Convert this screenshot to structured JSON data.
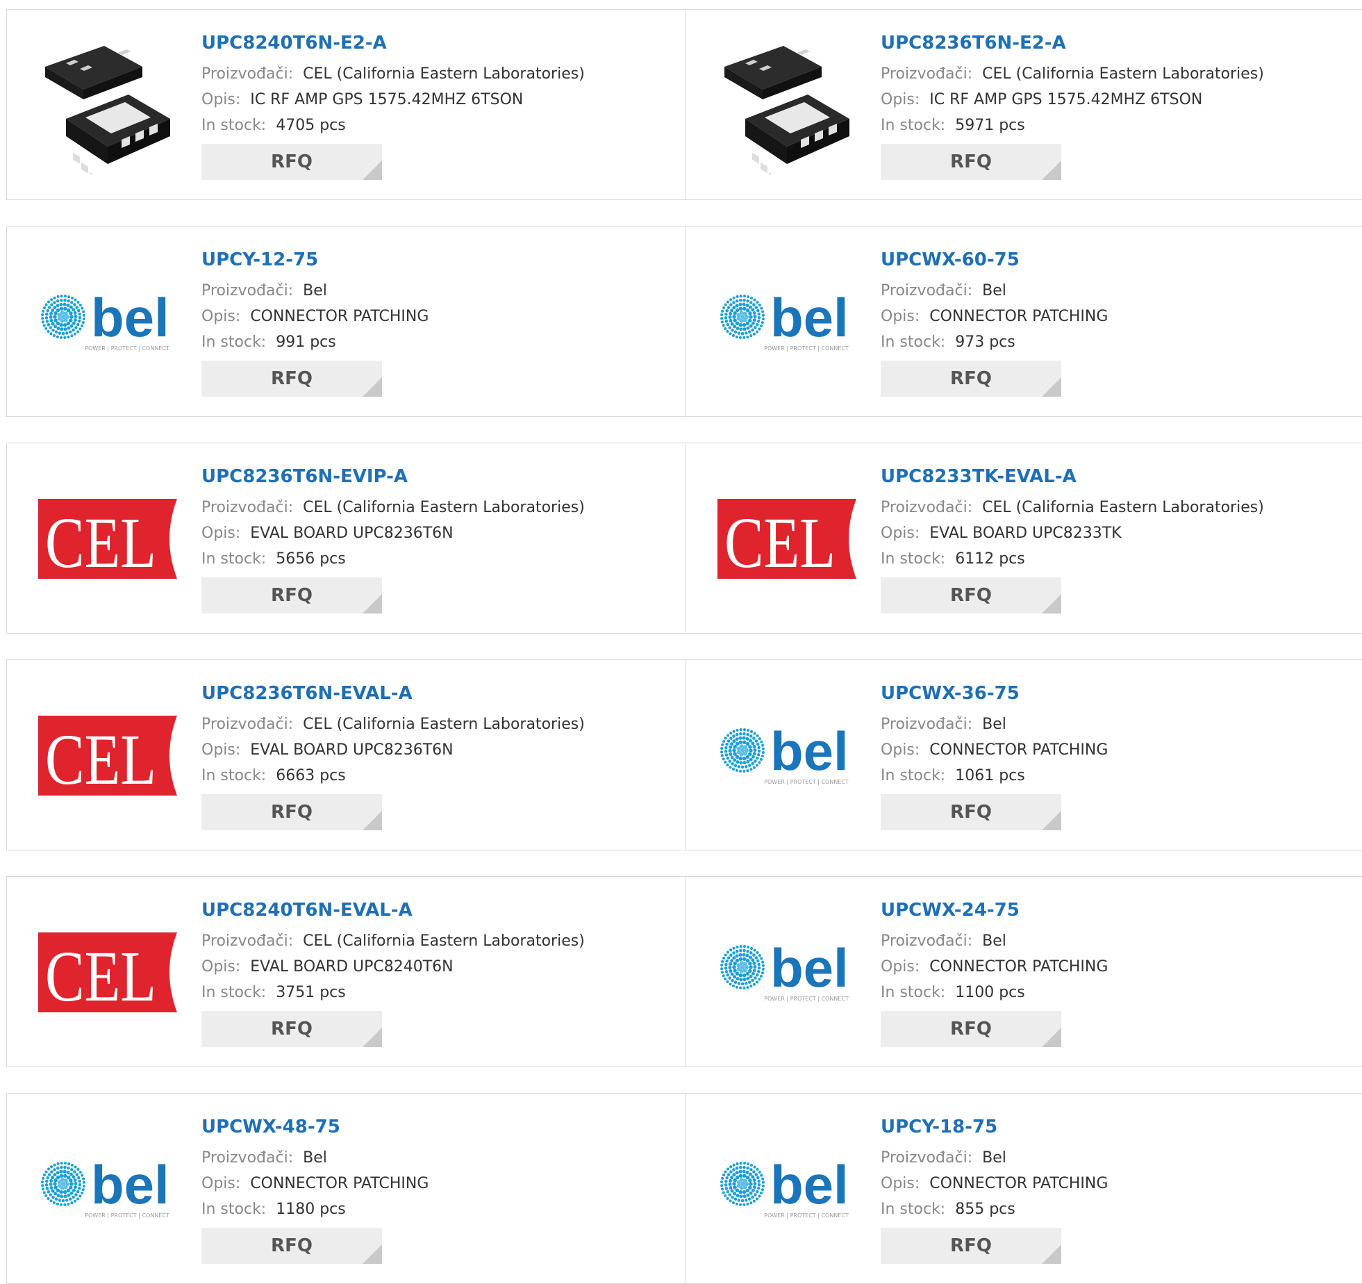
{
  "labels": {
    "manufacturer": "Proizvođači:",
    "description": "Opis:",
    "stock": "In stock:"
  },
  "colors": {
    "link": "#1f6fb5",
    "cel_red": "#e0242d",
    "bel_blue": "#1aa0d8",
    "bel_dark": "#1a75ba",
    "button_bg": "#ededed"
  },
  "products": [
    {
      "name": "UPC8240T6N-E2-A",
      "manufacturer": "CEL (California Eastern Laboratories)",
      "description": "IC RF AMP GPS 1575.42MHZ 6TSON",
      "stock": "4705 pcs",
      "image": "chip-package",
      "button": "RFQ"
    },
    {
      "name": "UPC8236T6N-E2-A",
      "manufacturer": "CEL (California Eastern Laboratories)",
      "description": "IC RF AMP GPS 1575.42MHZ 6TSON",
      "stock": "5971 pcs",
      "image": "chip-package",
      "button": "RFQ"
    },
    {
      "name": "UPCY-12-75",
      "manufacturer": "Bel",
      "description": "CONNECTOR PATCHING",
      "stock": "991 pcs",
      "image": "bel-logo",
      "button": "RFQ"
    },
    {
      "name": "UPCWX-60-75",
      "manufacturer": "Bel",
      "description": "CONNECTOR PATCHING",
      "stock": "973 pcs",
      "image": "bel-logo",
      "button": "RFQ"
    },
    {
      "name": "UPC8236T6N-EVIP-A",
      "manufacturer": "CEL (California Eastern Laboratories)",
      "description": "EVAL BOARD UPC8236T6N",
      "stock": "5656 pcs",
      "image": "cel-logo",
      "button": "RFQ"
    },
    {
      "name": "UPC8233TK-EVAL-A",
      "manufacturer": "CEL (California Eastern Laboratories)",
      "description": "EVAL BOARD UPC8233TK",
      "stock": "6112 pcs",
      "image": "cel-logo",
      "button": "RFQ"
    },
    {
      "name": "UPC8236T6N-EVAL-A",
      "manufacturer": "CEL (California Eastern Laboratories)",
      "description": "EVAL BOARD UPC8236T6N",
      "stock": "6663 pcs",
      "image": "cel-logo",
      "button": "RFQ"
    },
    {
      "name": "UPCWX-36-75",
      "manufacturer": "Bel",
      "description": "CONNECTOR PATCHING",
      "stock": "1061 pcs",
      "image": "bel-logo",
      "button": "RFQ"
    },
    {
      "name": "UPC8240T6N-EVAL-A",
      "manufacturer": "CEL (California Eastern Laboratories)",
      "description": "EVAL BOARD UPC8240T6N",
      "stock": "3751 pcs",
      "image": "cel-logo",
      "button": "RFQ"
    },
    {
      "name": "UPCWX-24-75",
      "manufacturer": "Bel",
      "description": "CONNECTOR PATCHING",
      "stock": "1100 pcs",
      "image": "bel-logo",
      "button": "RFQ"
    },
    {
      "name": "UPCWX-48-75",
      "manufacturer": "Bel",
      "description": "CONNECTOR PATCHING",
      "stock": "1180 pcs",
      "image": "bel-logo",
      "button": "RFQ"
    },
    {
      "name": "UPCY-18-75",
      "manufacturer": "Bel",
      "description": "CONNECTOR PATCHING",
      "stock": "855 pcs",
      "image": "bel-logo",
      "button": "RFQ"
    }
  ],
  "logos": {
    "cel_text": "CEL",
    "bel_text": "bel",
    "bel_tagline": "POWER | PROTECT | CONNECT"
  }
}
